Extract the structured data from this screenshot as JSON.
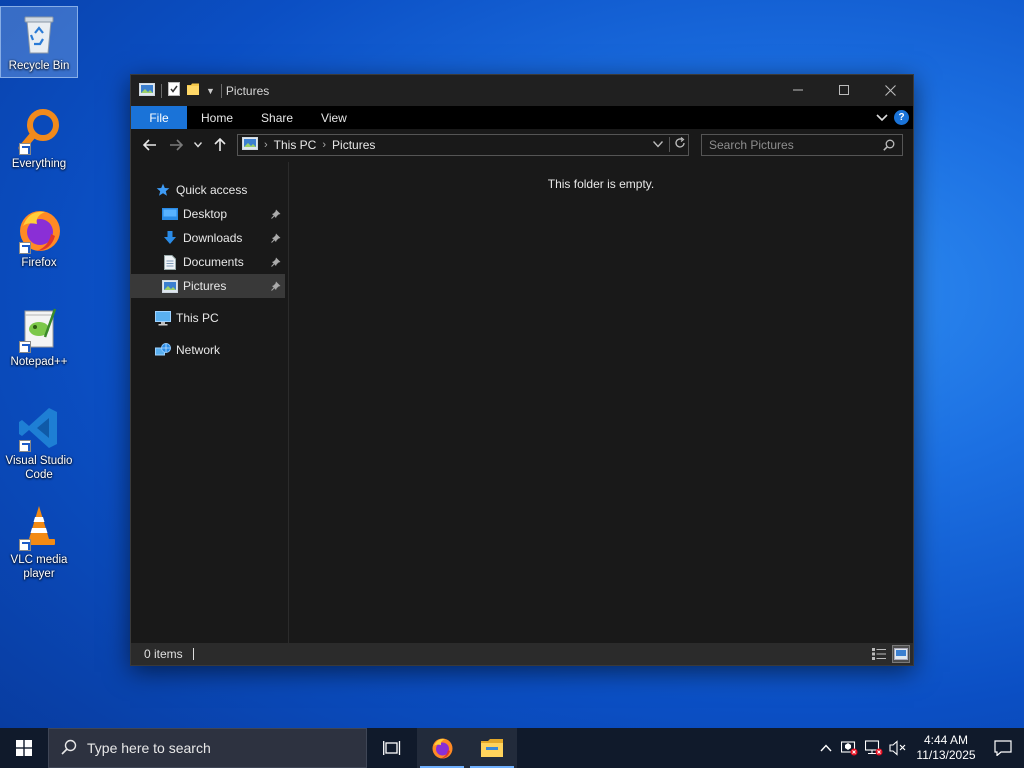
{
  "desktop": {
    "icons": [
      {
        "label": "Recycle Bin"
      },
      {
        "label": "Everything"
      },
      {
        "label": "Firefox"
      },
      {
        "label": "Notepad++"
      },
      {
        "label": "Visual Studio Code"
      },
      {
        "label": "VLC media player"
      }
    ]
  },
  "window": {
    "title": "Pictures",
    "ribbon_tabs": {
      "file": "File",
      "home": "Home",
      "share": "Share",
      "view": "View"
    },
    "address": {
      "crumb1": "This PC",
      "crumb2": "Pictures"
    },
    "search_placeholder": "Search Pictures",
    "nav_pane": {
      "quick_access": "Quick access",
      "desktop": "Desktop",
      "downloads": "Downloads",
      "documents": "Documents",
      "pictures": "Pictures",
      "this_pc": "This PC",
      "network": "Network"
    },
    "empty_message": "This folder is empty.",
    "status": "0 items"
  },
  "taskbar": {
    "search_placeholder": "Type here to search",
    "time": "4:44 AM",
    "date": "11/13/2025"
  },
  "colors": {
    "accent": "#1a73d8",
    "window_bg": "#191919",
    "taskbar_bg": "#101a2b"
  }
}
